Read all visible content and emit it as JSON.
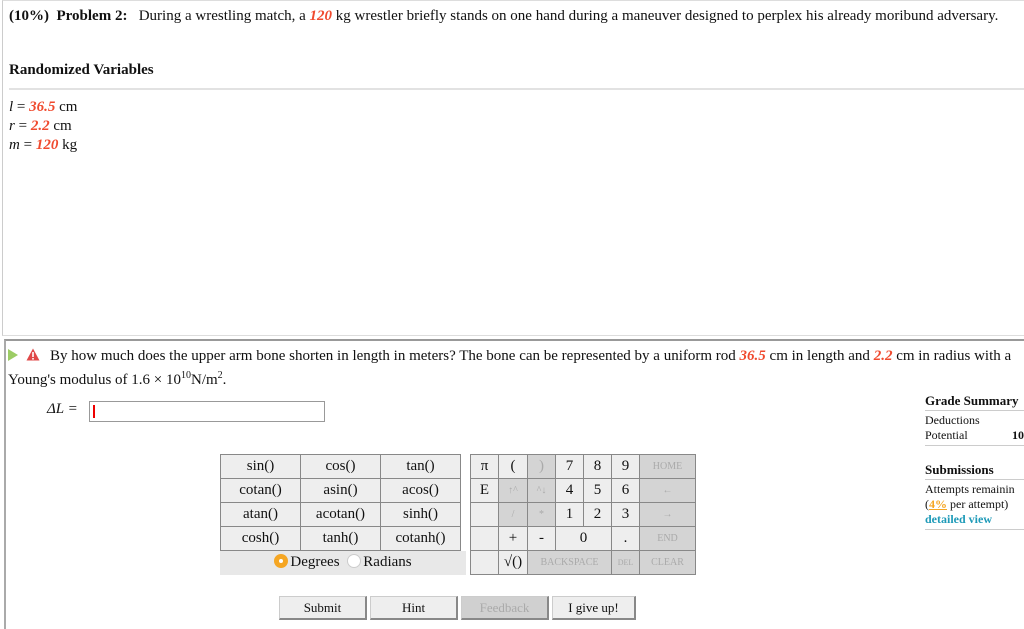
{
  "problem": {
    "weight": "(10%)",
    "label": "Problem 2:",
    "text_before": "During a wrestling match, a",
    "mass_value": "120",
    "text_after": "kg wrestler briefly stands on one hand during a maneuver designed to perplex his already moribund adversary."
  },
  "randomized_variables": {
    "title": "Randomized Variables",
    "items": [
      {
        "symbol": "l",
        "value": "36.5",
        "unit": "cm"
      },
      {
        "symbol": "r",
        "value": "2.2",
        "unit": "cm"
      },
      {
        "symbol": "m",
        "value": "120",
        "unit": "kg"
      }
    ]
  },
  "question": {
    "text1": "By how much does the upper arm bone shorten in length in meters? The bone can be represented by a uniform rod",
    "length_value": "36.5",
    "text2": "cm in length and",
    "radius_value": "2.2",
    "text3": "cm in radius with a Young's modulus of 1.6 × 10",
    "exponent": "10",
    "text4": "N/m",
    "unit_exp": "2",
    "text5": "."
  },
  "answer": {
    "label": "ΔL =",
    "value": ""
  },
  "functions": [
    [
      "sin()",
      "cos()",
      "tan()"
    ],
    [
      "cotan()",
      "asin()",
      "acos()"
    ],
    [
      "atan()",
      "acotan()",
      "sinh()"
    ],
    [
      "cosh()",
      "tanh()",
      "cotanh()"
    ]
  ],
  "angle_mode": {
    "degrees": "Degrees",
    "radians": "Radians",
    "selected": "Degrees"
  },
  "keypad": {
    "pi": "π",
    "lparen": "(",
    "rparen": ")",
    "k7": "7",
    "k8": "8",
    "k9": "9",
    "home": "HOME",
    "e": "E",
    "up": "↑^",
    "down": "^↓",
    "k4": "4",
    "k5": "5",
    "k6": "6",
    "left": "←",
    "div": "/",
    "mul": "*",
    "k1": "1",
    "k2": "2",
    "k3": "3",
    "right": "→",
    "plus": "+",
    "minus": "-",
    "k0": "0",
    "dot": ".",
    "end": "END",
    "sqrt": "√()",
    "backspace": "BACKSPACE",
    "del": "DEL",
    "clear": "CLEAR"
  },
  "grade_summary": {
    "title": "Grade Summary",
    "deductions_label": "Deductions",
    "potential_label": "Potential",
    "potential_value": "10",
    "submissions_title": "Submissions",
    "attempts_label": "Attempts remainin",
    "per_attempt_open": "(",
    "per_attempt_pct": "4%",
    "per_attempt_close": " per attempt)",
    "detailed_view": "detailed view"
  },
  "buttons": {
    "submit": "Submit",
    "hint": "Hint",
    "feedback": "Feedback",
    "give_up": "I give up!"
  }
}
